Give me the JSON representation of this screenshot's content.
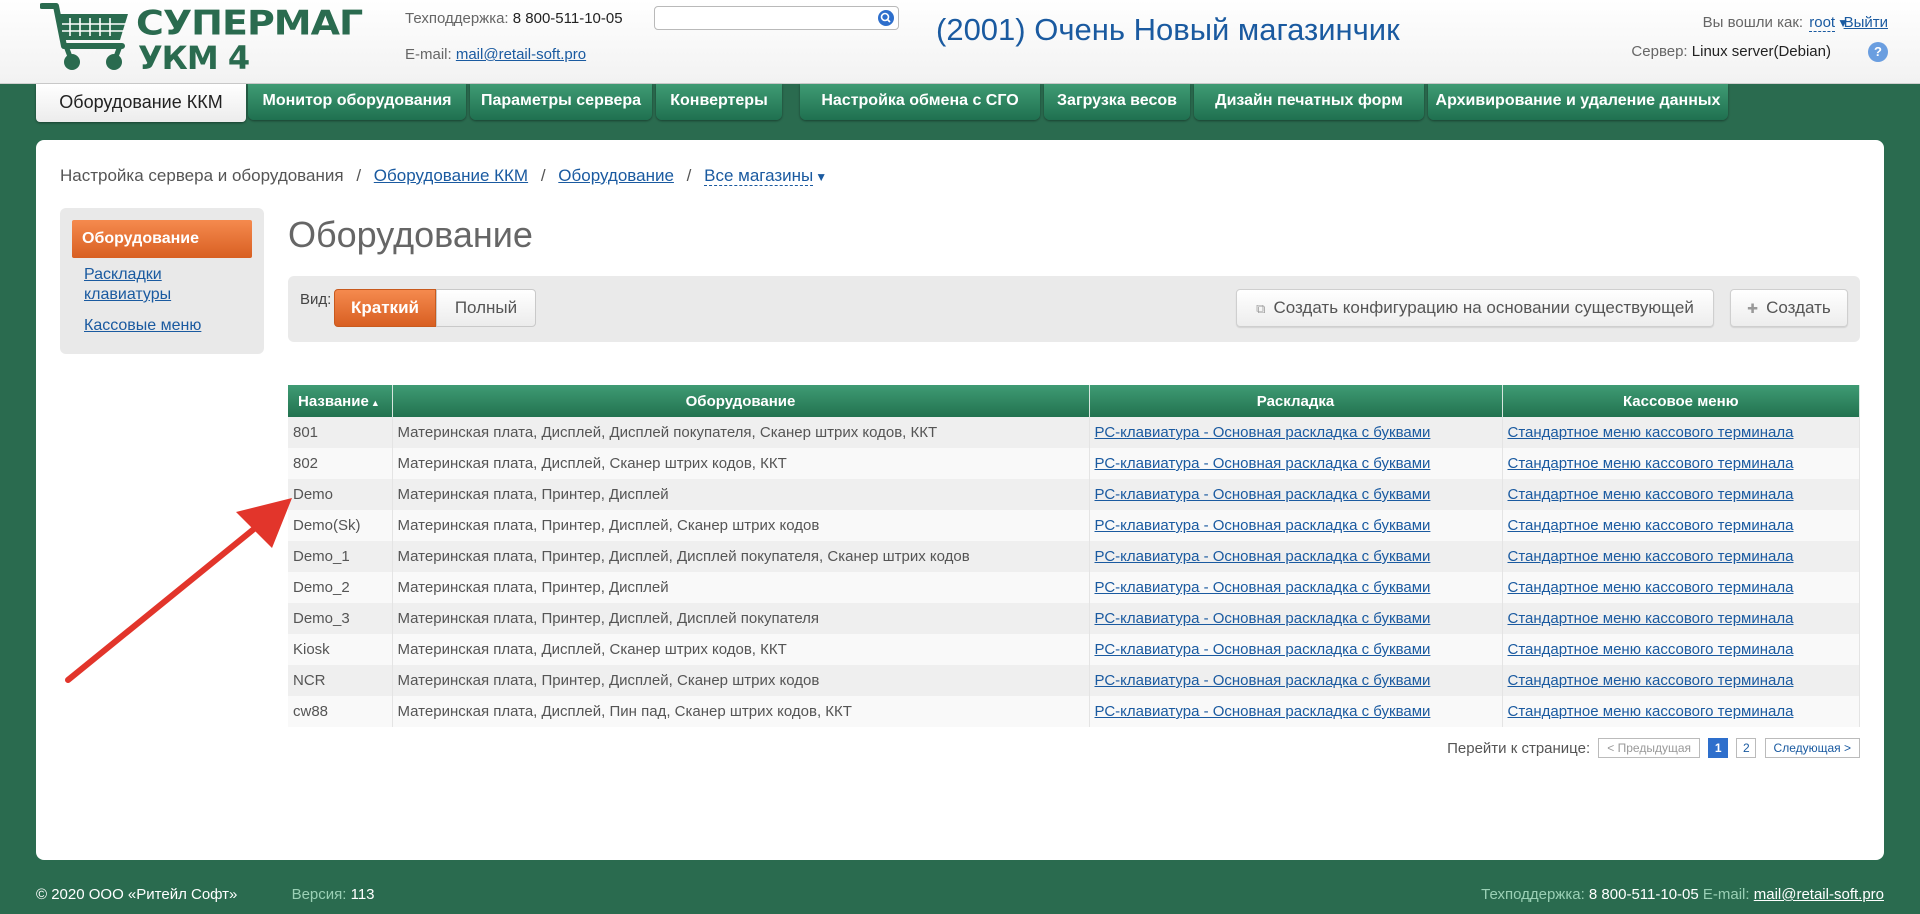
{
  "header": {
    "logo_line1": "СУПЕРМАГ",
    "logo_line2": "УКМ 4",
    "support_label": "Техподдержка:",
    "support_phone": "8 800-511-10-05",
    "email_label": "E-mail:",
    "email": "mail@retail-soft.pro",
    "search_value": "",
    "store_title": "(2001) Очень Новый магазинчик",
    "logged_label": "Вы вошли как:",
    "user": "root",
    "logout": "Выйти",
    "server_label": "Сервер:",
    "server_value": "Linux server(Debian)",
    "help": "?"
  },
  "tabs": [
    {
      "label": "Оборудование ККМ",
      "active": true
    },
    {
      "label": "Монитор оборудования"
    },
    {
      "label": "Параметры сервера"
    },
    {
      "label": "Конвертеры"
    },
    {
      "label": "Настройка обмена с СГО"
    },
    {
      "label": "Загрузка весов"
    },
    {
      "label": "Дизайн печатных форм"
    },
    {
      "label": "Архивирование и удаление данных"
    }
  ],
  "breadcrumb": {
    "root": "Настройка сервера и оборудования",
    "sep": "/",
    "item1": "Оборудование ККМ",
    "item2": "Оборудование",
    "item3": "Все магазины"
  },
  "sidebar": {
    "active": "Оборудование",
    "item1_line1": "Раскладки",
    "item1_line2": "клавиатуры",
    "item2": "Кассовые меню"
  },
  "page_title": "Оборудование",
  "toolbar": {
    "view_label": "Вид:",
    "view_short": "Краткий",
    "view_full": "Полный",
    "copy_button": "Создать конфигурацию на основании существующей",
    "create_button": "Создать"
  },
  "table": {
    "headers": [
      "Название",
      "Оборудование",
      "Раскладка",
      "Кассовое меню"
    ],
    "rows": [
      {
        "name": "801",
        "equipment": "Материнская плата, Дисплей, Дисплей покупателя, Сканер штрих кодов, ККТ",
        "layout": "РС-клавиатура - Основная раскладка с буквами",
        "menu": "Стандартное меню кассового терминала"
      },
      {
        "name": "802",
        "equipment": "Материнская плата, Дисплей, Сканер штрих кодов, ККТ",
        "layout": "РС-клавиатура - Основная раскладка с буквами",
        "menu": "Стандартное меню кассового терминала"
      },
      {
        "name": "Demo",
        "equipment": "Материнская плата, Принтер, Дисплей",
        "layout": "РС-клавиатура - Основная раскладка с буквами",
        "menu": "Стандартное меню кассового терминала"
      },
      {
        "name": "Demo(Sk)",
        "equipment": "Материнская плата, Принтер, Дисплей, Сканер штрих кодов",
        "layout": "РС-клавиатура - Основная раскладка с буквами",
        "menu": "Стандартное меню кассового терминала"
      },
      {
        "name": "Demo_1",
        "equipment": "Материнская плата, Принтер, Дисплей, Дисплей покупателя, Сканер штрих кодов",
        "layout": "РС-клавиатура - Основная раскладка с буквами",
        "menu": "Стандартное меню кассового терминала"
      },
      {
        "name": "Demo_2",
        "equipment": "Материнская плата, Принтер, Дисплей",
        "layout": "РС-клавиатура - Основная раскладка с буквами",
        "menu": "Стандартное меню кассового терминала"
      },
      {
        "name": "Demo_3",
        "equipment": "Материнская плата, Принтер, Дисплей, Дисплей покупателя",
        "layout": "РС-клавиатура - Основная раскладка с буквами",
        "menu": "Стандартное меню кассового терминала"
      },
      {
        "name": "Kiosk",
        "equipment": "Материнская плата, Дисплей, Сканер штрих кодов, ККТ",
        "layout": "РС-клавиатура - Основная раскладка с буквами",
        "menu": "Стандартное меню кассового терминала"
      },
      {
        "name": "NCR",
        "equipment": "Материнская плата, Принтер, Дисплей, Сканер штрих кодов",
        "layout": "РС-клавиатура - Основная раскладка с буквами",
        "menu": "Стандартное меню кассового терминала"
      },
      {
        "name": "cw88",
        "equipment": "Материнская плата, Дисплей, Пин пад, Сканер штрих кодов, ККТ",
        "layout": "РС-клавиатура - Основная раскладка с буквами",
        "menu": "Стандартное меню кассового терминала"
      }
    ]
  },
  "pager": {
    "label": "Перейти к странице:",
    "prev": "< Предыдущая",
    "page1": "1",
    "page2": "2",
    "next": "Следующая >"
  },
  "footer": {
    "copyright": "© 2020 ООО «Ритейл Софт»",
    "version_label": "Версия:",
    "version": "113",
    "support_label": "Техподдержка:",
    "support_phone": "8 800-511-10-05",
    "email_label": "E-mail:",
    "email": "mail@retail-soft.pro"
  },
  "colors": {
    "brand_green": "#2a6b4f",
    "tab_green": "#3f9b74",
    "accent_orange": "#e8733a",
    "link_blue": "#1a5aa0",
    "annotation_red": "#e2352b"
  }
}
